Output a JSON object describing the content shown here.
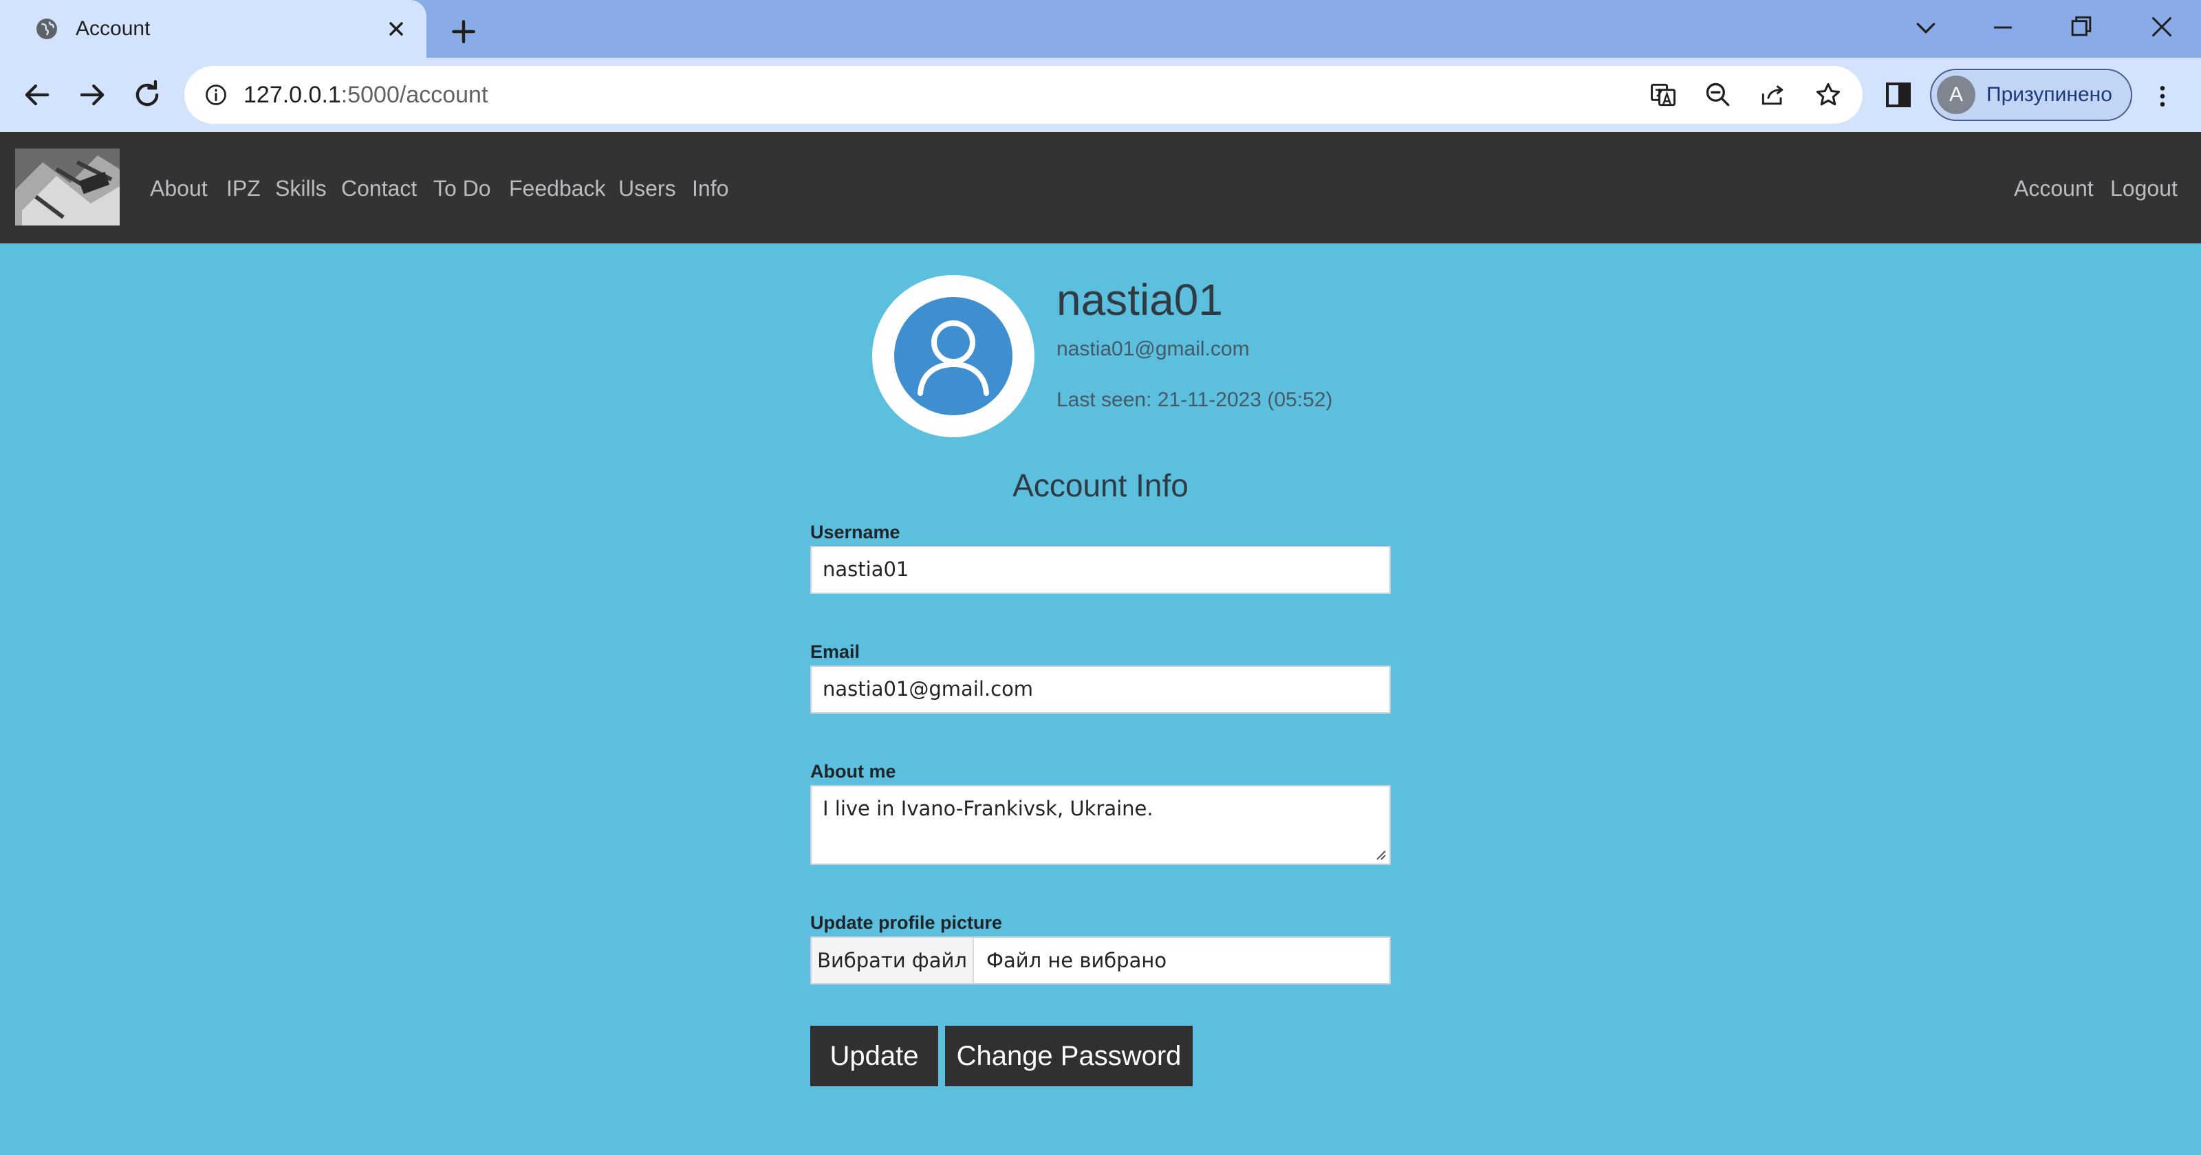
{
  "browser": {
    "tab_title": "Account",
    "url_host": "127.0.0.1",
    "url_path": ":5000/account",
    "profile_initial": "A",
    "profile_label": "Призупинено"
  },
  "nav": {
    "left": [
      "About",
      "IPZ",
      "Skills",
      "Contact",
      "To Do",
      "Feedback",
      "Users",
      "Info"
    ],
    "right": [
      "Account",
      "Logout"
    ]
  },
  "profile": {
    "username": "nastia01",
    "email": "nastia01@gmail.com",
    "last_seen": "Last seen: 21-11-2023 (05:52)"
  },
  "form": {
    "title": "Account Info",
    "username_label": "Username",
    "username_value": "nastia01",
    "email_label": "Email",
    "email_value": "nastia01@gmail.com",
    "about_label": "About me",
    "about_value": "I live in Ivano-Frankivsk, Ukraine.",
    "picture_label": "Update profile picture",
    "file_button": "Вибрати файл",
    "file_status": "Файл не вибрано",
    "update_button": "Update",
    "change_password_button": "Change Password"
  },
  "colors": {
    "page_bg": "#5bbfdd",
    "navbar_bg": "#333333",
    "tab_strip": "#89abe8",
    "avatar_blue": "#3e8ed0",
    "button_dark": "#303030"
  },
  "icons": [
    "globe-icon",
    "close-icon",
    "plus-icon",
    "chevron-down-icon",
    "minimize-icon",
    "restore-icon",
    "back-arrow-icon",
    "forward-arrow-icon",
    "reload-icon",
    "info-icon",
    "translate-icon",
    "zoom-out-icon",
    "share-icon",
    "star-icon",
    "side-panel-icon",
    "kebab-menu-icon",
    "user-silhouette-icon"
  ]
}
